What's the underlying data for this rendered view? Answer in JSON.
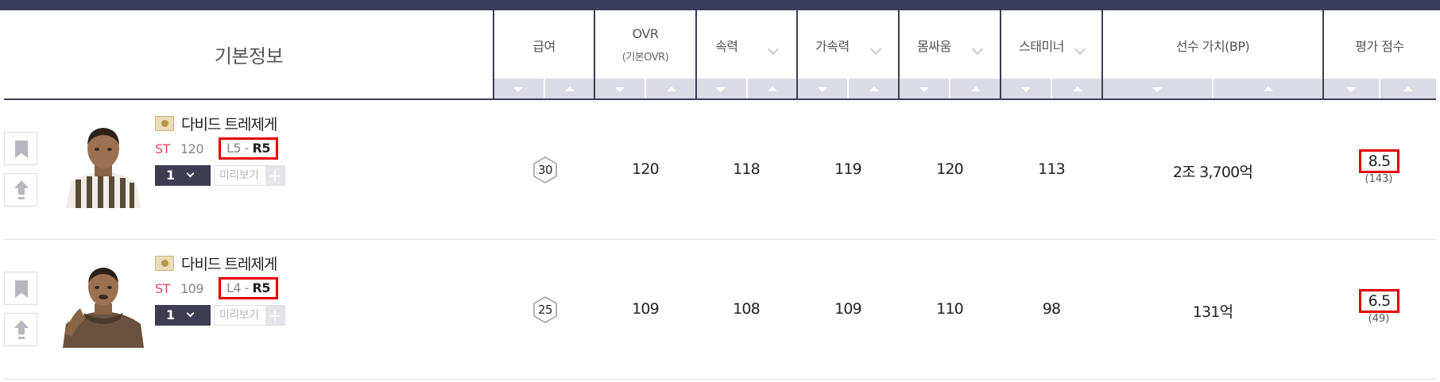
{
  "header": {
    "basic_info": "기본정보",
    "salary": "급여",
    "ovr": "OVR",
    "ovr_sub": "(기본OVR)",
    "speed": "속력",
    "acceleration": "가속력",
    "physical": "몸싸움",
    "stamina": "스태미너",
    "value": "선수 가치(BP)",
    "rating": "평가 점수"
  },
  "colors": {
    "header_bar": "#3c3d5a",
    "sort_bar": "#d9dbe5",
    "position": "#e84a5f",
    "highlight_border": "#e30000"
  },
  "rows": [
    {
      "name": "다비드 트레제게",
      "position": "ST",
      "pos_ovr": "120",
      "level": "L5",
      "rank": "R5",
      "grade": "1",
      "preview": "미리보기",
      "plus": "+",
      "salary": "30",
      "ovr": "120",
      "speed": "118",
      "acceleration": "119",
      "physical": "120",
      "stamina": "113",
      "value": "2조 3,700억",
      "score": "8.5",
      "score_count": "(143)"
    },
    {
      "name": "다비드 트레제게",
      "position": "ST",
      "pos_ovr": "109",
      "level": "L4",
      "rank": "R5",
      "grade": "1",
      "preview": "미리보기",
      "plus": "+",
      "salary": "25",
      "ovr": "109",
      "speed": "108",
      "acceleration": "109",
      "physical": "110",
      "stamina": "98",
      "value": "131억",
      "score": "6.5",
      "score_count": "(49)"
    }
  ]
}
